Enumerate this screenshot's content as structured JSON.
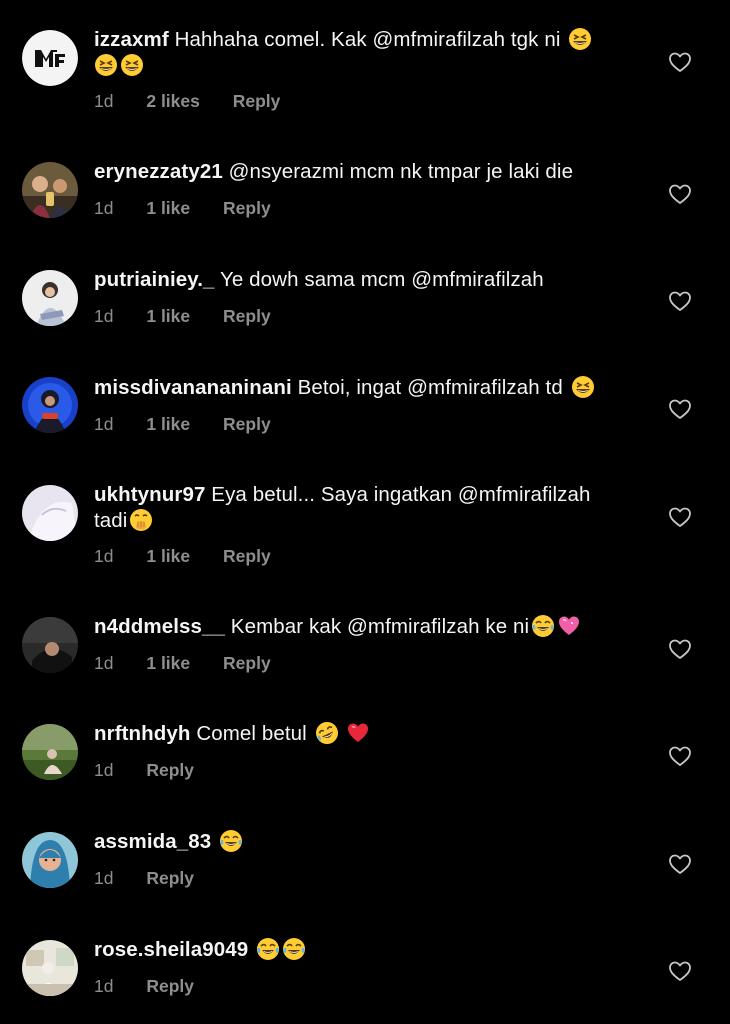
{
  "comments": [
    {
      "username": "izzaxmf",
      "text_before": "Hahhaha comel. Kak",
      "mention": "@mfmirafilzah",
      "text_after": "tgk ni",
      "emojis_line1": [
        "grinning-squinting"
      ],
      "emojis_line2": [
        "grinning-squinting",
        "grinning-squinting"
      ],
      "time": "1d",
      "likes": "2 likes",
      "reply": "Reply",
      "avatar_text": "MF"
    },
    {
      "username": "erynezzaty21",
      "mention": "@nsyerazmi",
      "text_after": "mcm nk tmpar je laki die",
      "time": "1d",
      "likes": "1 like",
      "reply": "Reply"
    },
    {
      "username": "putriainiey._",
      "text_before": "Ye dowh sama mcm",
      "mention": "@mfmirafilzah",
      "time": "1d",
      "likes": "1 like",
      "reply": "Reply"
    },
    {
      "username": "missdivanananinani",
      "text_before": "Betoi, ingat",
      "mention": "@mfmirafilzah",
      "text_after": "td",
      "time": "1d",
      "likes": "1 like",
      "reply": "Reply"
    },
    {
      "username": "ukhtynur97",
      "text_before": "Eya betul... Saya ingatkan",
      "mention": "@mfmirafilzah",
      "text_line2": "tadi",
      "time": "1d",
      "likes": "1 like",
      "reply": "Reply"
    },
    {
      "username": "n4ddmelss__",
      "text_before": "Kembar kak",
      "mention": "@mfmirafilzah",
      "text_after": "ke ni",
      "time": "1d",
      "likes": "1 like",
      "reply": "Reply"
    },
    {
      "username": "nrftnhdyh",
      "text_before": "Comel betul",
      "time": "1d",
      "reply": "Reply"
    },
    {
      "username": "assmida_83",
      "time": "1d",
      "reply": "Reply"
    },
    {
      "username": "rose.sheila9049",
      "time": "1d",
      "reply": "Reply"
    }
  ],
  "colors": {
    "background": "#000000",
    "text": "#f5f5f5",
    "meta": "#8e8e8e",
    "heart_stroke": "#c7c7c7"
  }
}
